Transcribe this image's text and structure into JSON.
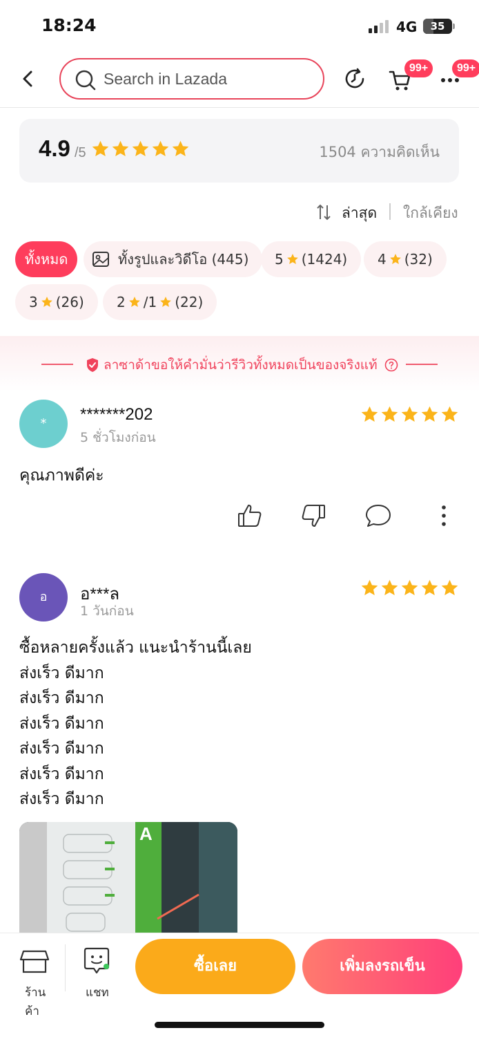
{
  "status_bar": {
    "time": "18:24",
    "network": "4G",
    "battery": "35",
    "battery_level": 0.35
  },
  "header": {
    "search_placeholder": "Search in Lazada",
    "cart_badge": "99+",
    "more_badge": "99+"
  },
  "rating_summary": {
    "score": "4.9",
    "max": "/5",
    "stars": 5,
    "review_count": "1504 ความคิดเห็น"
  },
  "sort": {
    "latest_label": "ล่าสุด",
    "relevance_label": "ใกล้เคียง"
  },
  "filters": [
    {
      "label": "ทั้งหมด",
      "active": true
    },
    {
      "label": "ทั้งรูปและวิดีโอ (445)",
      "icon": "image-icon"
    },
    {
      "prefix": "5",
      "suffix": "(1424)",
      "icon": "star-icon"
    },
    {
      "prefix": "4",
      "suffix": "(32)",
      "icon": "star-icon"
    },
    {
      "prefix": "3",
      "suffix": "(26)",
      "icon": "star-icon"
    },
    {
      "prefix": "2",
      "middle": "/1",
      "suffix": "(22)",
      "icon": "star-icon"
    }
  ],
  "guarantee": {
    "text": "ลาซาด้าขอให้คำมั่นว่ารีวิวทั้งหมดเป็นของจริงแท้"
  },
  "reviews": [
    {
      "avatar_letter": "*",
      "avatar_color": "#6dcfcf",
      "name": "*******202",
      "time": "5 ชั่วโมงก่อน",
      "stars": 5,
      "body": "คุณภาพดีค่ะ"
    },
    {
      "avatar_letter": "อ",
      "avatar_color": "#6a55b8",
      "name": "อ***ล",
      "time": "1 วันก่อน",
      "stars": 5,
      "body": "ซื้อหลายครั้งแล้ว แนะนำร้านนี้เลย\nส่งเร็ว ดีมาก\nส่งเร็ว ดีมาก\nส่งเร็ว ดีมาก\nส่งเร็ว ดีมาก\nส่งเร็ว ดีมาก\nส่งเร็ว ดีมาก",
      "photo_brand_text": "A"
    }
  ],
  "bottom_bar": {
    "store_label": "ร้านค้า",
    "chat_label": "แชท",
    "buy_label": "ซื้อเลย",
    "add_to_cart_label": "เพิ่มลงรถเข็น"
  },
  "colors": {
    "brand_pink": "#fe3d5c",
    "star": "#fbb41a",
    "buy": "#fbaa1a"
  }
}
